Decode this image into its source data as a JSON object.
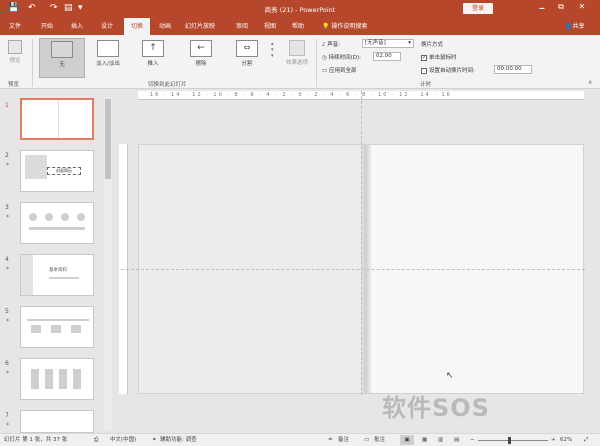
{
  "titlebar": {
    "title": "商务 (21) - PowerPoint",
    "signin": "登录",
    "controls": [
      "🗕",
      "⧉",
      "✕"
    ],
    "qat": [
      "💾",
      "↶",
      "↷",
      "▤",
      "▾"
    ]
  },
  "tabs": [
    "文件",
    "开始",
    "插入",
    "设计",
    "切换",
    "动画",
    "幻灯片放映",
    "审阅",
    "视图",
    "帮助"
  ],
  "tell_me": "操作说明搜索",
  "share": "共享",
  "ribbon": {
    "preview_label": "预览",
    "preview_group": "预览",
    "transitions": [
      "无",
      "淡入/淡出",
      "推入",
      "擦除",
      "分割"
    ],
    "effect_options": "效果选项",
    "transitions_group": "切换到此幻灯片",
    "sound_label": "声音:",
    "sound_value": "[无声音]",
    "duration_label": "持续时间(D):",
    "duration_value": "02.00",
    "apply_all": "应用到全部",
    "advance_title": "换片方式",
    "on_click": "单击鼠标时",
    "after_label": "设置自动换片时间:",
    "after_value": "00:00.00",
    "timing_group": "计时"
  },
  "thumbnails": [
    {
      "num": "1",
      "star": ""
    },
    {
      "num": "2",
      "star": "*",
      "text": "封面简历"
    },
    {
      "num": "3",
      "star": "*"
    },
    {
      "num": "4",
      "star": "*",
      "text": "基本资料"
    },
    {
      "num": "5",
      "star": "*"
    },
    {
      "num": "6",
      "star": "*"
    },
    {
      "num": "7",
      "star": "*"
    }
  ],
  "ruler_marks": "16 · 14 · 12 · 10 · 8 · 6 · 4 · 2 · 0 · 2 · 4 · 6 · 8 · 10 · 12 · 14 · 16",
  "status": {
    "slide_info": "幻灯片 第 1 张，共 37 张",
    "language": "中文(中国)",
    "accessibility": "辅助功能: 调查",
    "notes": "备注",
    "comments": "批注",
    "zoom": "62%"
  },
  "watermark": "软件SOS"
}
